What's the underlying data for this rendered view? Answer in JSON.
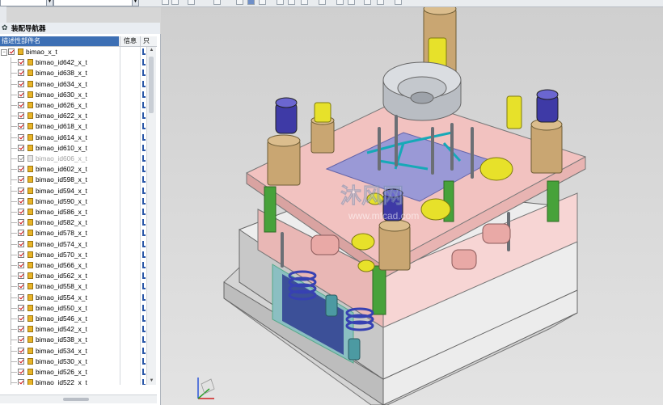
{
  "toolbar": {
    "combo1": "",
    "combo2": ""
  },
  "navigator": {
    "title": "装配导航器",
    "columns": {
      "name": "描述性部件名",
      "info": "信息",
      "only": "只"
    },
    "root": "bimao_x_t",
    "items": [
      {
        "label": "bimao_id642_x_t",
        "suppressed": false
      },
      {
        "label": "bimao_id638_x_t",
        "suppressed": false
      },
      {
        "label": "bimao_id634_x_t",
        "suppressed": false
      },
      {
        "label": "bimao_id630_x_t",
        "suppressed": false
      },
      {
        "label": "bimao_id626_x_t",
        "suppressed": false
      },
      {
        "label": "bimao_id622_x_t",
        "suppressed": false
      },
      {
        "label": "bimao_id618_x_t",
        "suppressed": false
      },
      {
        "label": "bimao_id614_x_t",
        "suppressed": false
      },
      {
        "label": "bimao_id610_x_t",
        "suppressed": false
      },
      {
        "label": "bimao_id606_x_t",
        "suppressed": true
      },
      {
        "label": "bimao_id602_x_t",
        "suppressed": false
      },
      {
        "label": "bimao_id598_x_t",
        "suppressed": false
      },
      {
        "label": "bimao_id594_x_t",
        "suppressed": false
      },
      {
        "label": "bimao_id590_x_t",
        "suppressed": false
      },
      {
        "label": "bimao_id586_x_t",
        "suppressed": false
      },
      {
        "label": "bimao_id582_x_t",
        "suppressed": false
      },
      {
        "label": "bimao_id578_x_t",
        "suppressed": false
      },
      {
        "label": "bimao_id574_x_t",
        "suppressed": false
      },
      {
        "label": "bimao_id570_x_t",
        "suppressed": false
      },
      {
        "label": "bimao_id566_x_t",
        "suppressed": false
      },
      {
        "label": "bimao_id562_x_t",
        "suppressed": false
      },
      {
        "label": "bimao_id558_x_t",
        "suppressed": false
      },
      {
        "label": "bimao_id554_x_t",
        "suppressed": false
      },
      {
        "label": "bimao_id550_x_t",
        "suppressed": false
      },
      {
        "label": "bimao_id546_x_t",
        "suppressed": false
      },
      {
        "label": "bimao_id542_x_t",
        "suppressed": false
      },
      {
        "label": "bimao_id538_x_t",
        "suppressed": false
      },
      {
        "label": "bimao_id534_x_t",
        "suppressed": false
      },
      {
        "label": "bimao_id530_x_t",
        "suppressed": false
      },
      {
        "label": "bimao_id526_x_t",
        "suppressed": false
      },
      {
        "label": "bimao_id522_x_t",
        "suppressed": false
      }
    ]
  },
  "watermark": {
    "text_cn": "沐风网",
    "url": "www.mfcad.com"
  },
  "colors": {
    "plate_pink": "#f2c2c0",
    "base_grey": "#ececec",
    "accent_blue": "#3d6fb4",
    "check_red": "#d01010",
    "pillar_green": "#47a23a"
  }
}
